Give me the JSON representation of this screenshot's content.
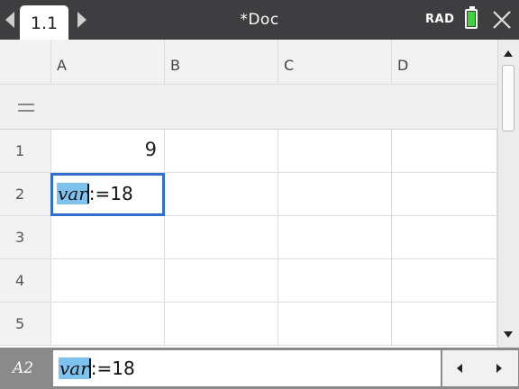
{
  "toolbar": {
    "tab_label": "1.1",
    "doc_title": "*Doc",
    "angle_mode": "RAD",
    "battery_color": "#3fd23c"
  },
  "sheet": {
    "columns": [
      "A",
      "B",
      "C",
      "D"
    ],
    "rows": [
      "1",
      "2",
      "3",
      "4",
      "5"
    ],
    "formula_row_symbol": "=",
    "cells": {
      "A1": "9",
      "A2": {
        "var": "var",
        "rest": ":=18"
      }
    }
  },
  "entry_line": {
    "cell_ref": "A2",
    "var": "var",
    "rest": ":=18"
  },
  "colors": {
    "accent": "#2f6fcd",
    "highlight": "#7ec3f0",
    "topbar": "#3e3e40",
    "entry_bar": "#8a8a8a"
  }
}
